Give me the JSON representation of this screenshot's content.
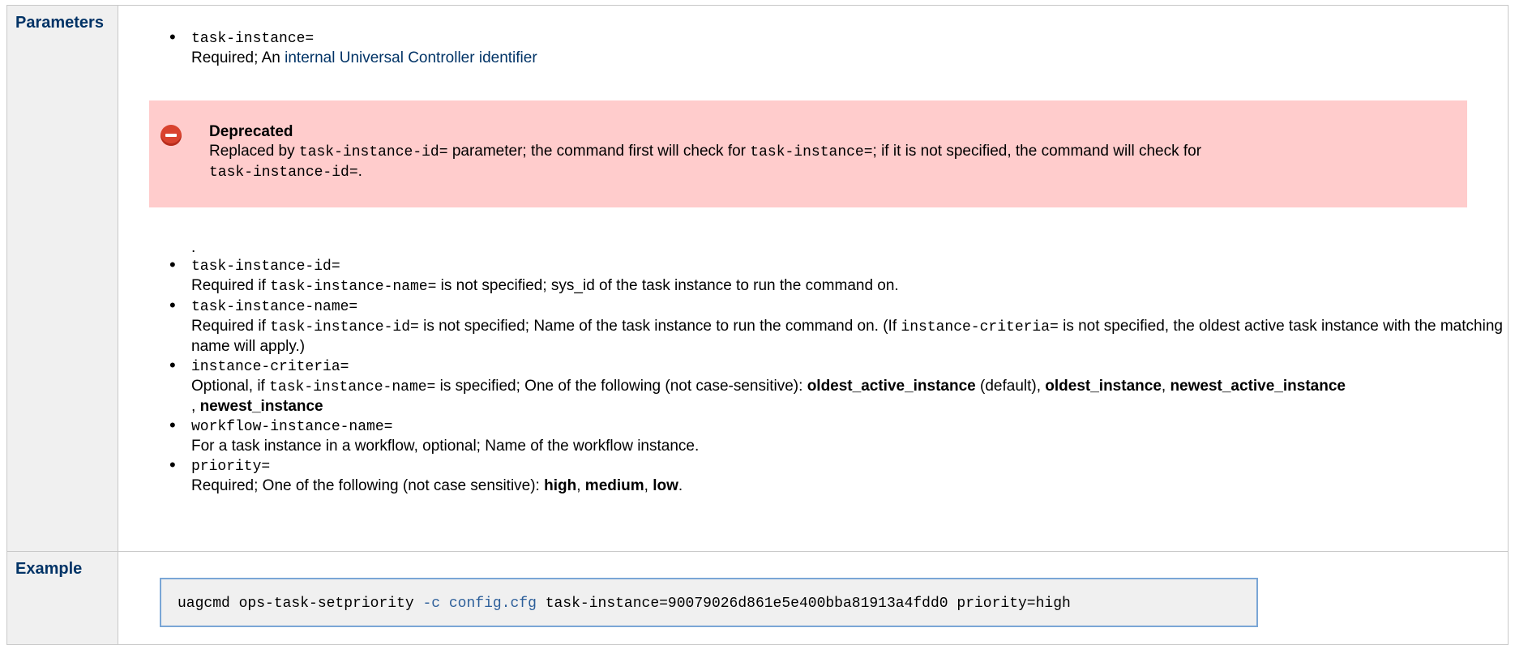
{
  "labels": {
    "parameters": "Parameters",
    "example": "Example"
  },
  "params": {
    "task_instance": {
      "name": "task-instance=",
      "desc_prefix": "Required; An ",
      "desc_link": "internal Universal Controller identifier"
    },
    "deprecated": {
      "title": "Deprecated",
      "text1": "Replaced by ",
      "code1": "task-instance-id=",
      "text2": " parameter; the command first will check for ",
      "code2": "task-instance=",
      "text3": "; if it is not specified, the command will check for ",
      "code3": "task-instance-id=",
      "text4": "."
    },
    "dot": ".",
    "task_instance_id": {
      "name": "task-instance-id=",
      "t1": "Required if ",
      "c1": "task-instance-name=",
      "t2": " is not specified; sys_id of the task instance to run the command on."
    },
    "task_instance_name": {
      "name": "task-instance-name=",
      "t1": "Required if ",
      "c1": "task-instance-id=",
      "t2": " is not specified; Name of the task instance to run the command on. (If ",
      "c2": "instance-criteria=",
      "t3": " is not specified, the oldest active task instance with the matching name will apply.)"
    },
    "instance_criteria": {
      "name": "instance-criteria=",
      "t1": "Optional, if ",
      "c1": "task-instance-name=",
      "t2": " is specified; One of the following (not case-sensitive): ",
      "b1": "oldest_active_instance",
      "t3": " (default), ",
      "b2": "oldest_instance",
      "t4": ", ",
      "b3": "newest_active_instance",
      "t5": ", ",
      "b4": "newest_instance"
    },
    "workflow_instance_name": {
      "name": "workflow-instance-name=",
      "desc": "For a task instance in a workflow, optional; Name of the workflow instance."
    },
    "priority": {
      "name": "priority=",
      "t1": "Required; One of the following (not case sensitive): ",
      "b1": "high",
      "t2": ", ",
      "b2": "medium",
      "t3": ", ",
      "b3": "low",
      "t4": "."
    }
  },
  "example": {
    "cmd": "uagcmd ops-task-setpriority ",
    "opt": "-c",
    "sp": " ",
    "cfg": "config.cfg",
    "rest": " task-instance=90079026d861e5e400bba81913a4fdd0 priority=high"
  },
  "colors": {
    "label": "#003366",
    "link": "#003366",
    "deprecated_bg": "#ffcccc",
    "code_border": "#7aa6d6",
    "code_keyword": "#2d5f9a"
  }
}
